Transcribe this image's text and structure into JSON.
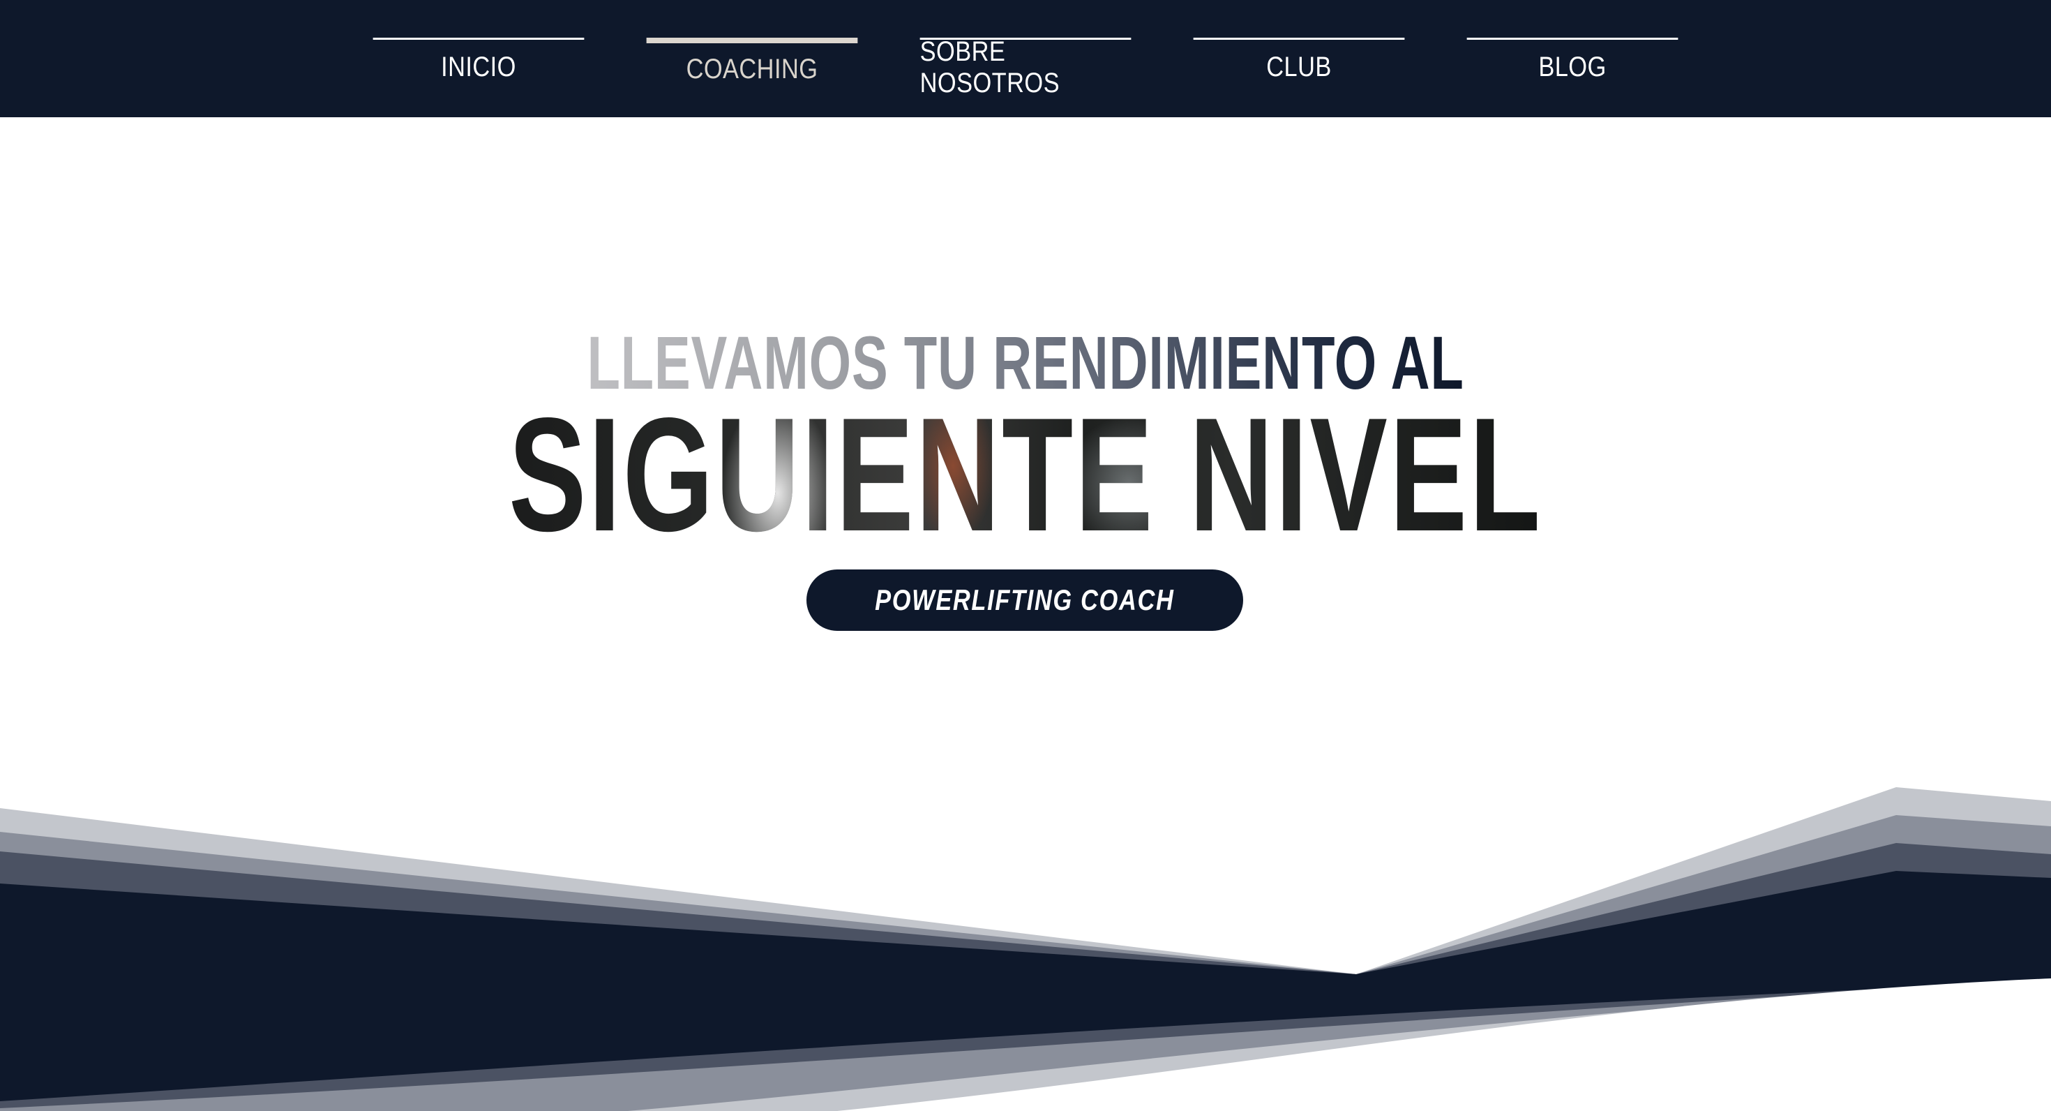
{
  "nav": {
    "items": [
      {
        "label": "INICIO",
        "active": false
      },
      {
        "label": "COACHING",
        "active": true
      },
      {
        "label": "SOBRE NOSOTROS",
        "active": false
      },
      {
        "label": "CLUB",
        "active": false
      },
      {
        "label": "BLOG",
        "active": false
      }
    ]
  },
  "hero": {
    "line1": "LLEVAMOS TU RENDIMIENTO AL",
    "line2": "SIGUIENTE NIVEL",
    "badge": "POWERLIFTING COACH"
  },
  "colors": {
    "navy": "#0e182b",
    "active_underline": "#dcd6cf",
    "wave_light": "#c3c6cc",
    "wave_mid": "#8a8f9b",
    "wave_dark": "#4b5263"
  }
}
